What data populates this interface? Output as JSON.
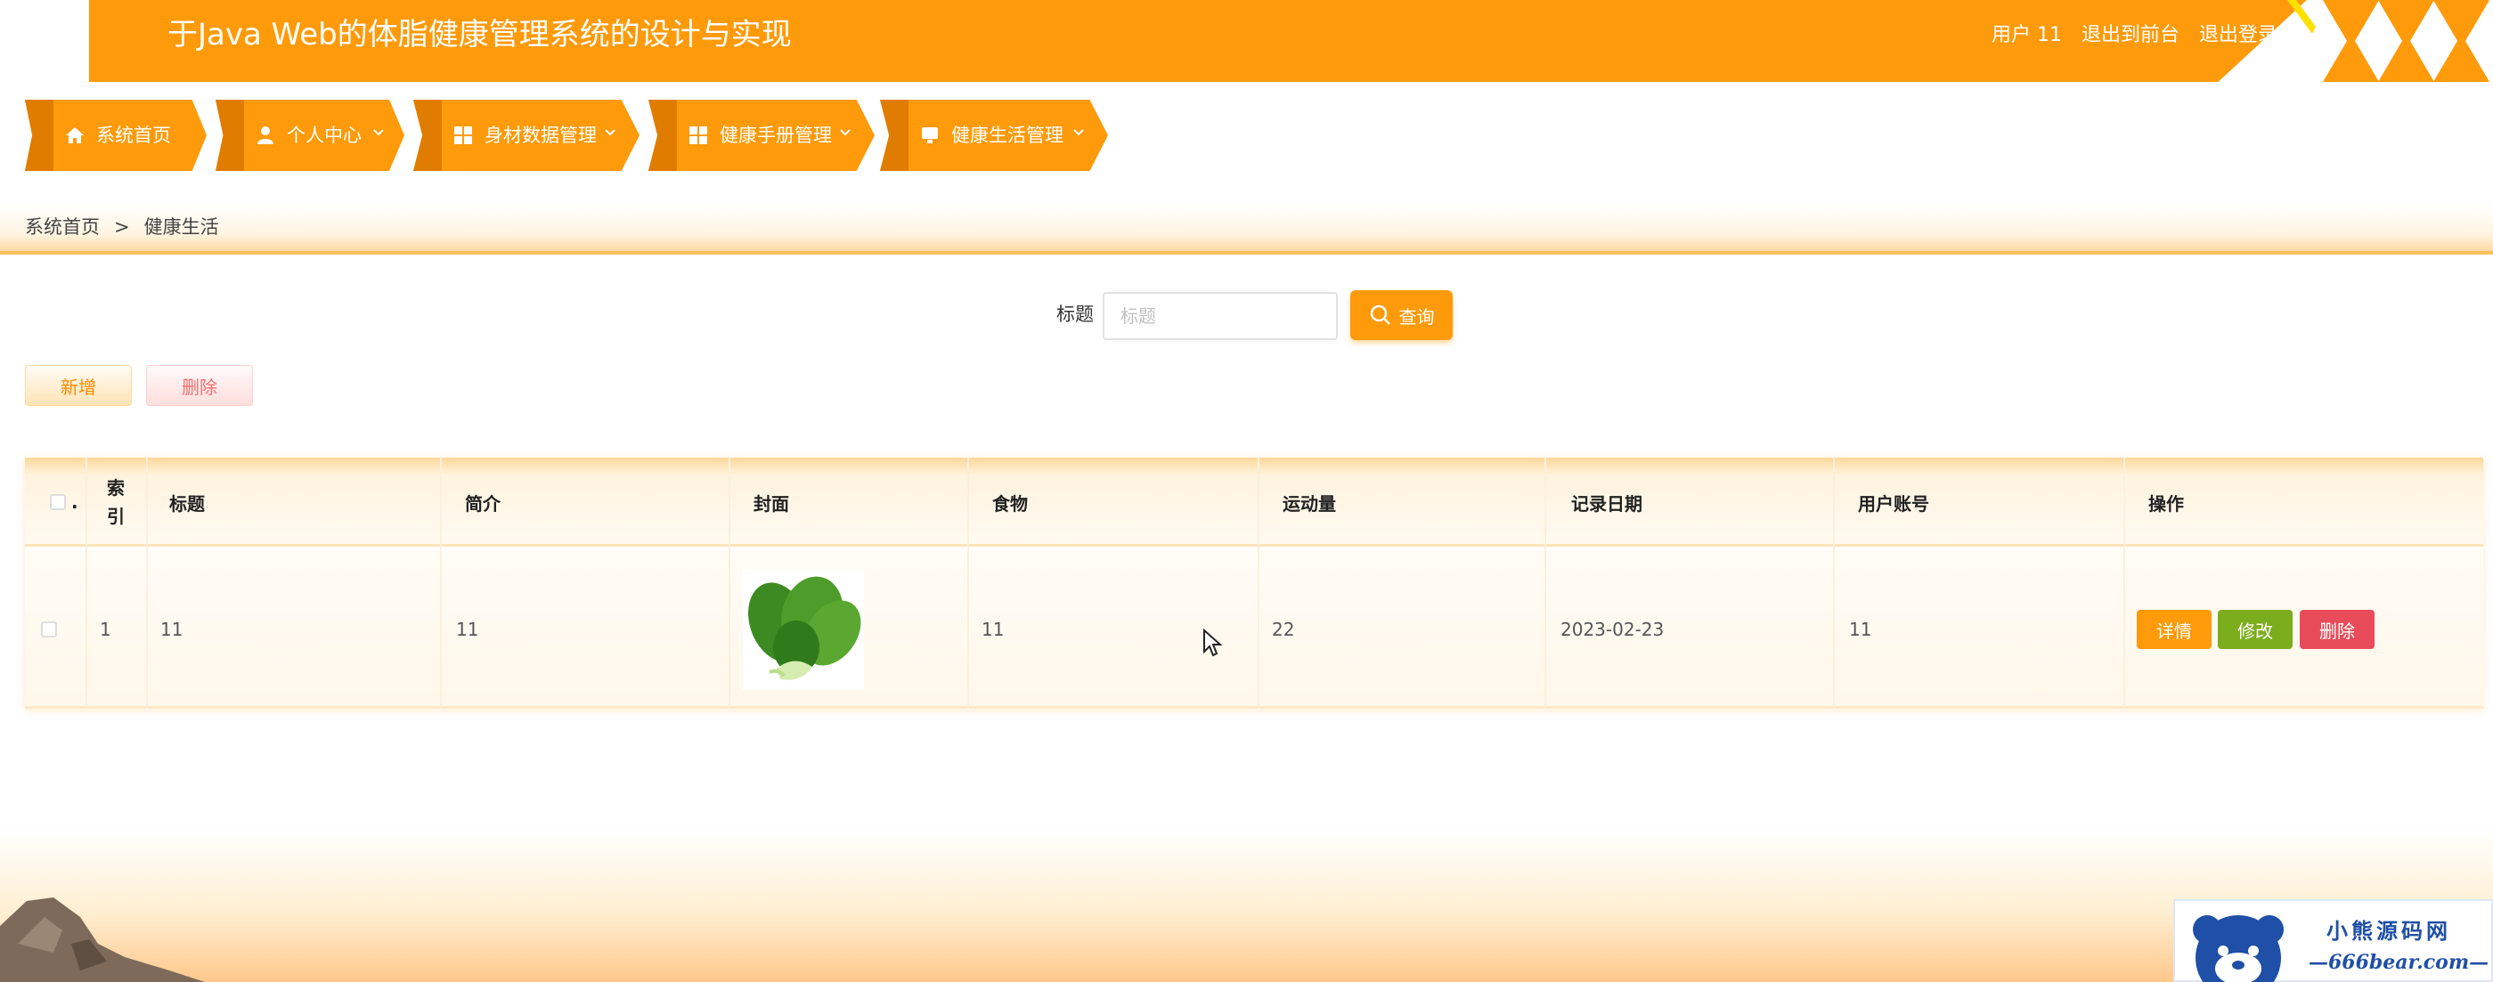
{
  "header": {
    "title": "于Java Web的体脂健康管理系统的设计与实现",
    "user_label": "用户 11",
    "to_front": "退出到前台",
    "logout": "退出登录"
  },
  "nav": [
    {
      "label": "系统首页",
      "icon": "home-icon"
    },
    {
      "label": "个人中心",
      "icon": "user-icon"
    },
    {
      "label": "身材数据管理",
      "icon": "grid-icon"
    },
    {
      "label": "健康手册管理",
      "icon": "grid-icon"
    },
    {
      "label": "健康生活管理",
      "icon": "monitor-icon"
    }
  ],
  "breadcrumb": {
    "home": "系统首页",
    "separator": ">",
    "current": "健康生活"
  },
  "search": {
    "label": "标题",
    "placeholder": "标题",
    "button": "查询"
  },
  "actions": {
    "add": "新增",
    "delete": "删除"
  },
  "table": {
    "headers": {
      "select": ".",
      "index": "索引",
      "title": "标题",
      "intro": "简介",
      "cover": "封面",
      "food": "食物",
      "exercise": "运动量",
      "date": "记录日期",
      "account": "用户账号",
      "ops": "操作"
    },
    "rows": [
      {
        "index": "1",
        "title": "11",
        "intro": "11",
        "cover": "bok-choy-image",
        "food": "11",
        "exercise": "22",
        "date": "2023-02-23",
        "account": "11",
        "detail": "详情",
        "edit": "修改",
        "remove": "删除"
      }
    ]
  },
  "watermark": {
    "name": "小熊源码网",
    "url": "—666bear.com—"
  },
  "colors": {
    "accent": "#ff9a0a",
    "edit": "#7cad1c",
    "remove": "#e84c5a"
  }
}
